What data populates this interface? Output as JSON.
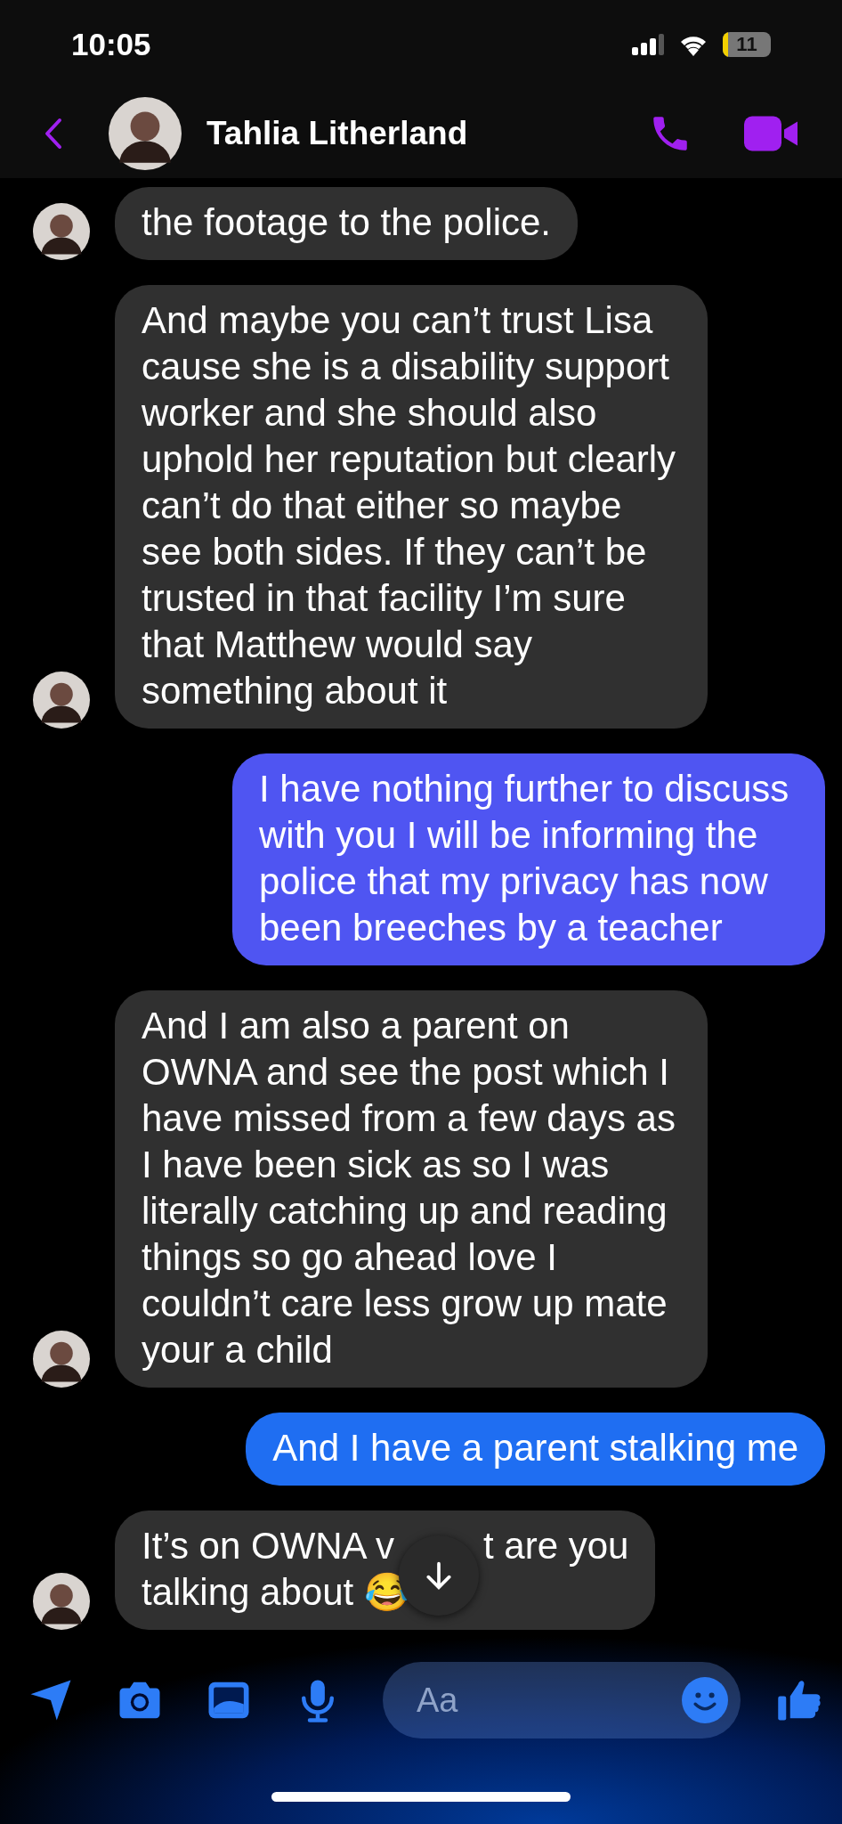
{
  "status_bar": {
    "time": "10:05",
    "battery": "11"
  },
  "header": {
    "name": "Tahlia Litherland"
  },
  "messages": [
    {
      "kind": "received",
      "text": "the footage to the police."
    },
    {
      "kind": "received",
      "text": "And maybe you can’t trust Lisa cause she is a disability support worker and she should also uphold her reputation but clearly can’t do that either so maybe see both sides. If they can’t be trusted in that facility I’m sure that Matthew would say something about it"
    },
    {
      "kind": "sent",
      "color": "#4f55f2",
      "text": "I have nothing further to discuss with you I will be informing the police that my privacy has now been breeches by a teacher"
    },
    {
      "kind": "received",
      "text": "And I am also a parent on OWNA and see the post which I have missed from a few days as I have been sick as so I was literally catching up and reading things so go ahead love I couldn’t care less grow up mate your a child"
    },
    {
      "kind": "sent",
      "color": "#1f6ef2",
      "text": "And I have a parent stalking me"
    },
    {
      "kind": "received",
      "text": "It’s on OWNA v",
      "text_after": "t are you",
      "text_line2": "talking about 😂"
    }
  ],
  "composer": {
    "placeholder": "Aa"
  }
}
